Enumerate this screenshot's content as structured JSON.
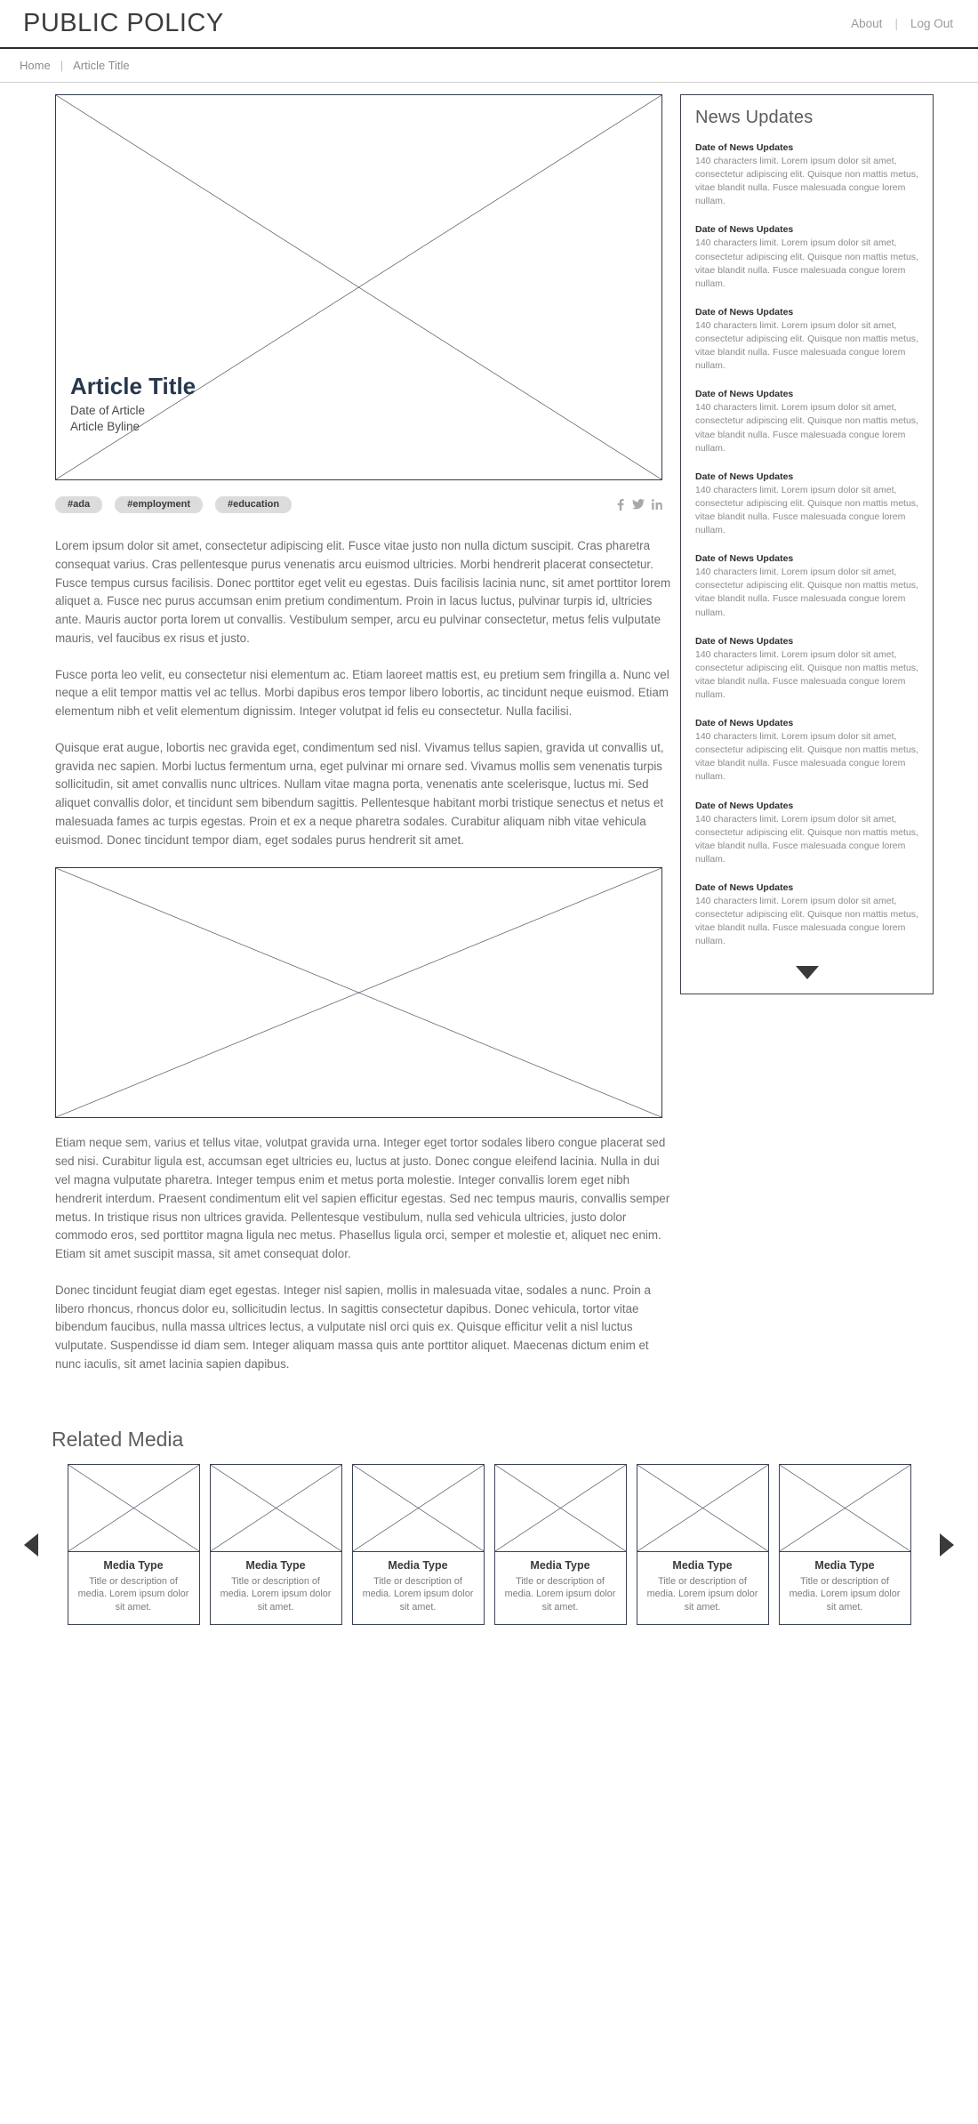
{
  "header": {
    "brand": "PUBLIC POLICY",
    "nav": [
      {
        "label": "About"
      },
      {
        "label": "Log Out"
      }
    ],
    "separator": "|"
  },
  "breadcrumb": {
    "home": "Home",
    "separator": "|",
    "current": "Article Title"
  },
  "hero": {
    "title": "Article Title",
    "date": "Date of Article",
    "byline": "Article Byline"
  },
  "tags": [
    {
      "label": "#ada"
    },
    {
      "label": "#employment"
    },
    {
      "label": "#education"
    }
  ],
  "social": [
    {
      "name": "facebook-icon"
    },
    {
      "name": "twitter-icon"
    },
    {
      "name": "linkedin-icon"
    }
  ],
  "article": {
    "paragraphs": [
      "Lorem ipsum dolor sit amet, consectetur adipiscing elit. Fusce vitae justo non nulla dictum suscipit. Cras pharetra consequat varius. Cras pellentesque purus venenatis arcu euismod ultricies. Morbi hendrerit placerat consectetur. Fusce tempus cursus facilisis. Donec porttitor eget velit eu egestas. Duis facilisis lacinia nunc, sit amet porttitor lorem aliquet a. Fusce nec purus accumsan enim pretium condimentum. Proin in lacus luctus, pulvinar turpis id, ultricies ante. Mauris auctor porta lorem ut convallis. Vestibulum semper, arcu eu pulvinar consectetur, metus felis vulputate mauris, vel faucibus ex risus et justo.",
      "Fusce porta leo velit, eu consectetur nisi elementum ac. Etiam laoreet mattis est, eu pretium sem fringilla a. Nunc vel neque a elit tempor mattis vel ac tellus. Morbi dapibus eros tempor libero lobortis, ac tincidunt neque euismod. Etiam elementum nibh et velit elementum dignissim. Integer volutpat id felis eu consectetur. Nulla facilisi.",
      "Quisque erat augue, lobortis nec gravida eget, condimentum sed nisl. Vivamus tellus sapien, gravida ut convallis ut, gravida nec sapien. Morbi luctus fermentum urna, eget pulvinar mi ornare sed. Vivamus mollis sem venenatis turpis sollicitudin, sit amet convallis nunc ultrices. Nullam vitae magna porta, venenatis ante scelerisque, luctus mi. Sed aliquet convallis dolor, et tincidunt sem bibendum sagittis. Pellentesque habitant morbi tristique senectus et netus et malesuada fames ac turpis egestas. Proin et ex a neque pharetra sodales. Curabitur aliquam nibh vitae vehicula euismod. Donec tincidunt tempor diam, eget sodales purus hendrerit sit amet."
    ],
    "paragraphs_after_figure": [
      "Etiam neque sem, varius et tellus vitae, volutpat gravida urna. Integer eget tortor sodales libero congue placerat sed sed nisi. Curabitur ligula est, accumsan eget ultricies eu, luctus at justo. Donec congue eleifend lacinia. Nulla in dui vel magna vulputate pharetra. Integer tempus enim et metus porta molestie. Integer convallis lorem eget nibh hendrerit interdum. Praesent condimentum elit vel sapien efficitur egestas. Sed nec tempus mauris, convallis semper metus. In tristique risus non ultrices gravida. Pellentesque vestibulum, nulla sed vehicula ultricies, justo dolor commodo eros, sed porttitor magna ligula nec metus. Phasellus ligula orci, semper et molestie et, aliquet nec enim. Etiam sit amet suscipit massa, sit amet consequat dolor.",
      "Donec tincidunt feugiat diam eget egestas. Integer nisl sapien, mollis in malesuada vitae, sodales a nunc. Proin a libero rhoncus, rhoncus dolor eu, sollicitudin lectus. In sagittis consectetur dapibus. Donec vehicula, tortor vitae bibendum faucibus, nulla massa ultrices lectus, a vulputate nisl orci quis ex. Quisque efficitur velit a nisl luctus vulputate. Suspendisse id diam sem. Integer aliquam massa quis ante porttitor aliquet. Maecenas dictum enim et nunc iaculis, sit amet lacinia sapien dapibus."
    ]
  },
  "news": {
    "heading": "News Updates",
    "items": [
      {
        "date": "Date of News Updates",
        "text": "140 characters limit. Lorem ipsum dolor sit amet, consectetur adipiscing elit. Quisque non mattis metus, vitae blandit nulla. Fusce malesuada congue lorem nullam."
      },
      {
        "date": "Date of News Updates",
        "text": "140 characters limit. Lorem ipsum dolor sit amet, consectetur adipiscing elit. Quisque non mattis metus, vitae blandit nulla. Fusce malesuada congue lorem nullam."
      },
      {
        "date": "Date of News Updates",
        "text": "140 characters limit. Lorem ipsum dolor sit amet, consectetur adipiscing elit. Quisque non mattis metus, vitae blandit nulla. Fusce malesuada congue lorem nullam."
      },
      {
        "date": "Date of News Updates",
        "text": "140 characters limit. Lorem ipsum dolor sit amet, consectetur adipiscing elit. Quisque non mattis metus, vitae blandit nulla. Fusce malesuada congue lorem nullam."
      },
      {
        "date": "Date of News Updates",
        "text": "140 characters limit. Lorem ipsum dolor sit amet, consectetur adipiscing elit. Quisque non mattis metus, vitae blandit nulla. Fusce malesuada congue lorem nullam."
      },
      {
        "date": "Date of News Updates",
        "text": "140 characters limit. Lorem ipsum dolor sit amet, consectetur adipiscing elit. Quisque non mattis metus, vitae blandit nulla. Fusce malesuada congue lorem nullam."
      },
      {
        "date": "Date of News Updates",
        "text": "140 characters limit. Lorem ipsum dolor sit amet, consectetur adipiscing elit. Quisque non mattis metus, vitae blandit nulla. Fusce malesuada congue lorem nullam."
      },
      {
        "date": "Date of News Updates",
        "text": "140 characters limit. Lorem ipsum dolor sit amet, consectetur adipiscing elit. Quisque non mattis metus, vitae blandit nulla. Fusce malesuada congue lorem nullam."
      },
      {
        "date": "Date of News Updates",
        "text": "140 characters limit. Lorem ipsum dolor sit amet, consectetur adipiscing elit. Quisque non mattis metus, vitae blandit nulla. Fusce malesuada congue lorem nullam."
      },
      {
        "date": "Date of News Updates",
        "text": "140 characters limit. Lorem ipsum dolor sit amet, consectetur adipiscing elit. Quisque non mattis metus, vitae blandit nulla. Fusce malesuada congue lorem nullam."
      }
    ],
    "more_icon": "caret-down-icon"
  },
  "related": {
    "heading": "Related Media",
    "prev_icon": "caret-left-icon",
    "next_icon": "caret-right-icon",
    "cards": [
      {
        "type": "Media Type",
        "desc": "Title or description of media. Lorem ipsum dolor sit amet."
      },
      {
        "type": "Media Type",
        "desc": "Title or description of media. Lorem ipsum dolor sit amet."
      },
      {
        "type": "Media Type",
        "desc": "Title or description of media. Lorem ipsum dolor sit amet."
      },
      {
        "type": "Media Type",
        "desc": "Title or description of media. Lorem ipsum dolor sit amet."
      },
      {
        "type": "Media Type",
        "desc": "Title or description of media. Lorem ipsum dolor sit amet."
      },
      {
        "type": "Media Type",
        "desc": "Title or description of media. Lorem ipsum dolor sit amet."
      }
    ]
  },
  "colors": {
    "navy": "#2f3a4e",
    "body_text": "#6e6e6e",
    "muted": "#9a9a9a",
    "tag_bg": "#dcdcdc"
  }
}
